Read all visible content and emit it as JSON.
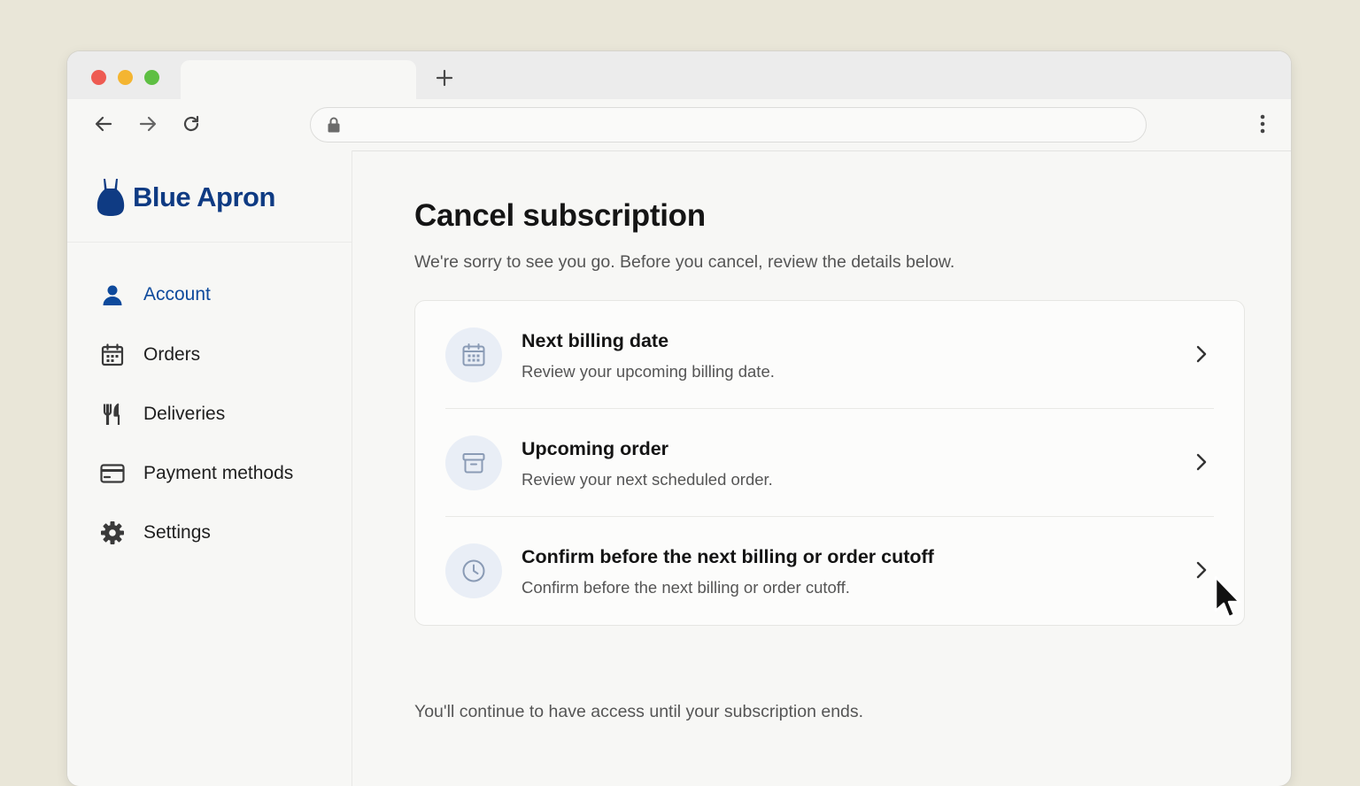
{
  "browser": {
    "tab_title": "",
    "new_tab_label": "+",
    "url": ""
  },
  "sidebar": {
    "brand": {
      "name": "Blue Apron",
      "logo_icon": "apron-logo-icon",
      "color": "#0f3b83"
    },
    "items": [
      {
        "label": "Account",
        "icon": "user-icon",
        "active": true
      },
      {
        "label": "Orders",
        "icon": "calendar-icon",
        "active": false
      },
      {
        "label": "Deliveries",
        "icon": "utensils-icon",
        "active": false
      },
      {
        "label": "Payment methods",
        "icon": "credit-card-icon",
        "active": false
      },
      {
        "label": "Settings",
        "icon": "gear-icon",
        "active": false
      }
    ]
  },
  "main": {
    "title": "Cancel subscription",
    "subtitle": "We're sorry to see you go. Before you cancel, review the details below.",
    "rows": [
      {
        "title": "Next billing date",
        "description": "Review your upcoming billing date.",
        "icon": "calendar-icon"
      },
      {
        "title": "Upcoming order",
        "description": "Review your next scheduled order.",
        "icon": "box-icon"
      },
      {
        "title": "Confirm before the next billing or order cutoff",
        "description": "Confirm before the next billing or order cutoff.",
        "icon": "clock-icon"
      }
    ],
    "footnote": "You'll continue to have access until your subscription ends."
  },
  "colors": {
    "accent": "#0e4a9c",
    "background": "#e9e6d8",
    "icon_badge": "#e9eef6"
  }
}
